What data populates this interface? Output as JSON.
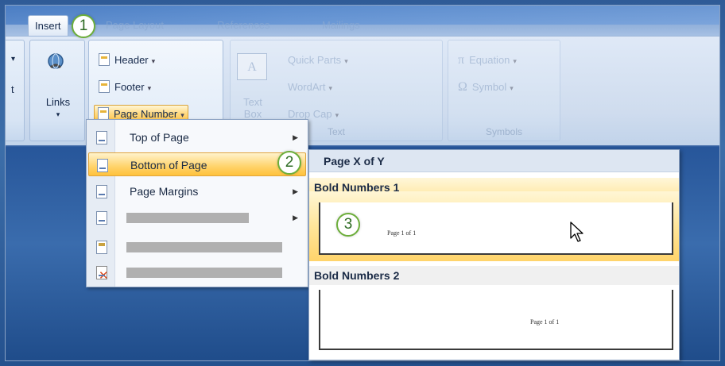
{
  "tabs": [
    {
      "label": "Insert",
      "active": true
    },
    {
      "label": "Page Layout",
      "active": false
    },
    {
      "label": "References",
      "active": false
    },
    {
      "label": "Mailings",
      "active": false
    }
  ],
  "ribbon": {
    "links_label": "Links",
    "header_footer": {
      "header": "Header",
      "footer": "Footer",
      "page_number": "Page Number"
    },
    "text_group": {
      "text_box": "Text\nBox",
      "quick_parts": "Quick Parts",
      "wordart": "WordArt",
      "drop_cap": "Drop Cap",
      "group_label": "Text"
    },
    "symbols_group": {
      "equation": "Equation",
      "symbol": "Symbol",
      "group_label": "Symbols"
    }
  },
  "callouts": [
    "1",
    "2",
    "3"
  ],
  "menu": {
    "items": [
      {
        "label": "Top of Page",
        "submenu": true
      },
      {
        "label": "Bottom of Page",
        "submenu": true,
        "highlighted": true
      },
      {
        "label": "Page Margins",
        "submenu": true
      }
    ]
  },
  "gallery": {
    "header": "Page X of Y",
    "sections": [
      {
        "title": "Bold Numbers 1",
        "preview_text": "Page 1 of 1"
      },
      {
        "title": "Bold Numbers 2",
        "preview_text": "Page 1 of 1"
      }
    ]
  },
  "colors": {
    "highlight": "#ffd36b",
    "callout_border": "#6cae3a"
  }
}
